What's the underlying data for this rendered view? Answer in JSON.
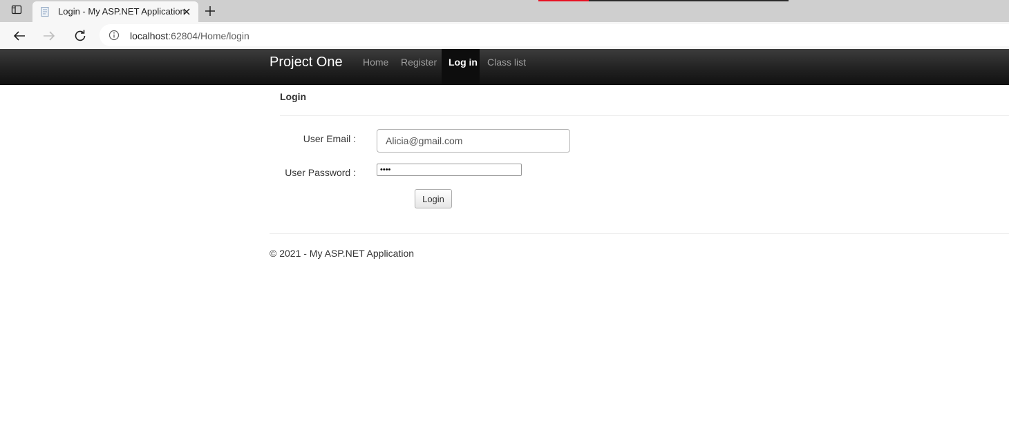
{
  "browser": {
    "tab": {
      "title": "Login - My ASP.NET Application"
    },
    "address": {
      "host": "localhost",
      "rest": ":62804/Home/login"
    }
  },
  "site": {
    "brand": "Project One",
    "nav": [
      {
        "label": "Home",
        "active": false
      },
      {
        "label": "Register",
        "active": false
      },
      {
        "label": "Log in",
        "active": true
      },
      {
        "label": "Class list",
        "active": false
      }
    ]
  },
  "form": {
    "title": "Login",
    "email_label": "User Email :",
    "email_value": "Alicia@gmail.com",
    "password_label": "User Password :",
    "password_value": "1234",
    "submit_label": "Login"
  },
  "footer": {
    "text": "© 2021 - My ASP.NET Application"
  },
  "colors": {
    "navbar": "#222222",
    "active_nav": "#0d0d0d",
    "media_bar": "#e81123"
  },
  "icons": [
    "sidebar-toggle-icon",
    "page-favicon-icon",
    "close-icon",
    "plus-icon",
    "back-arrow-icon",
    "forward-arrow-icon",
    "reload-icon",
    "info-icon"
  ]
}
